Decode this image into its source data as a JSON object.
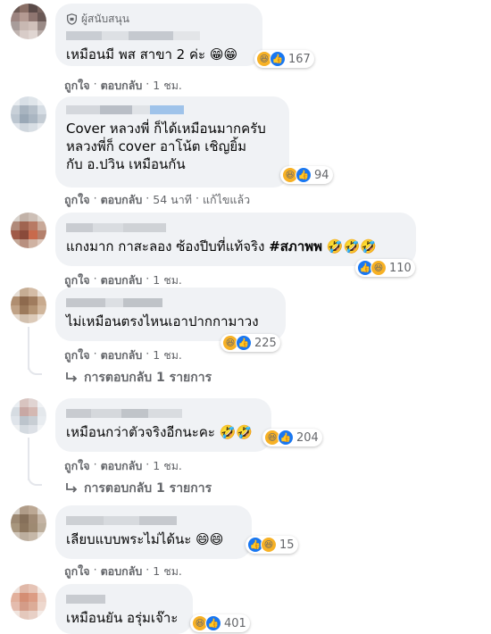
{
  "comments": [
    {
      "supporter_label": "ผู้สนับสนุน",
      "text": "เหมือนมี พส สาขา 2 ค่ะ",
      "inline_emojis": "😁😁",
      "reactions": [
        "haha",
        "like"
      ],
      "reaction_count": "167",
      "actions": {
        "like": "ถูกใจ",
        "reply": "ตอบกลับ",
        "time": "1 ชม."
      }
    },
    {
      "text": "Cover หลวงพี่ ก็ได้เหมือนมากครับ\nหลวงพี่ก็ cover อาโน้ต เชิญยิ้ม\nกับ อ.ปวิน เหมือนกัน",
      "reactions": [
        "haha",
        "like"
      ],
      "reaction_count": "94",
      "actions": {
        "like": "ถูกใจ",
        "reply": "ตอบกลับ",
        "time": "54 นาที",
        "edited": "แก้ไขแล้ว"
      }
    },
    {
      "text": "แกงมาก กาสะลอง ซ้องปีบที่แท้จริง",
      "hashtag": "#สภาพพ",
      "inline_emojis": "🤣🤣🤣",
      "reactions": [
        "like",
        "haha"
      ],
      "reaction_count": "110",
      "actions": {
        "like": "ถูกใจ",
        "reply": "ตอบกลับ",
        "time": "1 ชม."
      }
    },
    {
      "text": "ไม่เหมือนตรงไหนเอาปากกามาวง",
      "reactions": [
        "haha",
        "like"
      ],
      "reaction_count": "225",
      "actions": {
        "like": "ถูกใจ",
        "reply": "ตอบกลับ",
        "time": "1 ชม."
      },
      "replies_label": "การตอบกลับ 1 รายการ"
    },
    {
      "text": "เหมือนกว่าตัวจริงอีกนะคะ",
      "inline_emojis": "🤣🤣",
      "reactions": [
        "haha",
        "like"
      ],
      "reaction_count": "204",
      "actions": {
        "like": "ถูกใจ",
        "reply": "ตอบกลับ",
        "time": "1 ชม."
      },
      "replies_label": "การตอบกลับ 1 รายการ"
    },
    {
      "text": "เลียบแบบพระไม่ได้นะ",
      "inline_emojis": "😄😄",
      "reactions": [
        "like",
        "haha"
      ],
      "reaction_count": "15",
      "actions": {
        "like": "ถูกใจ",
        "reply": "ตอบกลับ",
        "time": "1 ชม."
      }
    },
    {
      "text": "เหมือนยัน อรุ่มเจ๊าะ",
      "reactions": [
        "haha",
        "like"
      ],
      "reaction_count": "401",
      "actions": {}
    }
  ],
  "colors": {
    "bubble": "#f0f2f5",
    "meta": "#65676b",
    "like_blue": "#1877f2",
    "haha_yellow": "#f7b125"
  }
}
